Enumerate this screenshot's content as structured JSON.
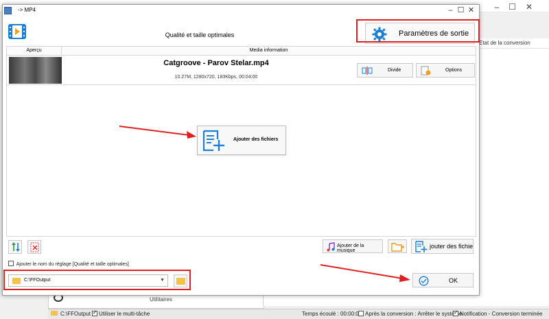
{
  "background_window": {
    "column_header": "Etat de la conversion",
    "utilities_label": "Utilitaires",
    "controls": [
      "–",
      "☐",
      "✕"
    ]
  },
  "status_bar": {
    "output_path": "C:\\FFOutput",
    "multitask_label": "Utiliser le multi-tâche",
    "elapsed": "Temps écoulé : 00:00:00",
    "after_conversion": "Après la conversion : Arrêter le système",
    "notification": "Notification - Conversion terminée"
  },
  "dialog": {
    "title": "-> MP4",
    "controls": [
      "–",
      "☐",
      "✕"
    ],
    "header_title": "Qualité et taille optimales",
    "output_params_label": "Paramètres de sortie",
    "columns": {
      "preview": "Aperçu",
      "media_info": "Media information"
    },
    "file": {
      "name": "Catgroove - Parov Stelar.mp4",
      "meta": "10.27M, 1280x720, 183Kbps, 00:04:00"
    },
    "divide_label": "Divide",
    "options_label": "Options",
    "add_files_center_label": "Ajouter des fichiers",
    "add_music_label": "Ajouter de la musique",
    "add_files_bottom_label": "jouter des fichier",
    "preset_checkbox_label": "Ajouter le nom du réglage [Qualité et taille optimales]",
    "output_folder": "C:\\FFOutput",
    "ok_label": "OK"
  },
  "colors": {
    "annotation_red": "#e02020",
    "accent_blue": "#1a7fd4",
    "folder_yellow": "#f3c24a"
  },
  "icons": [
    "film-icon",
    "gear-icon",
    "divide-icon",
    "options-icon",
    "add-files-icon",
    "sort-icon",
    "delete-icon",
    "music-icon",
    "folder-add-icon",
    "folder-icon",
    "ok-check-icon"
  ]
}
